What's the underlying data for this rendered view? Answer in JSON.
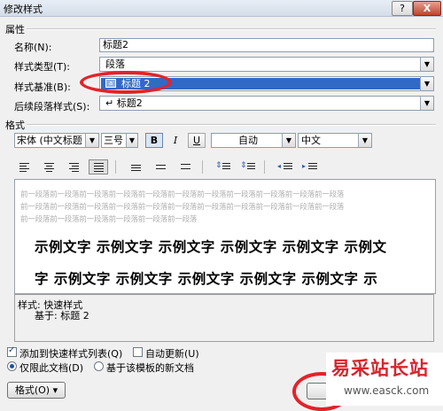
{
  "window": {
    "title": "修改样式",
    "help": "?",
    "close": "X"
  },
  "properties": {
    "section": "属性",
    "name_label": "名称(N):",
    "name_value": "标题2",
    "type_label": "样式类型(T):",
    "type_value": "段落",
    "based_label": "样式基准(B):",
    "based_value": "标题 2",
    "next_label": "后续段落样式(S):",
    "next_value": "↵ 标题2"
  },
  "format": {
    "section": "格式",
    "font": "宋体 (中文标题",
    "size": "三号",
    "bold": "B",
    "italic": "I",
    "underline": "U",
    "color": "自动",
    "lang": "中文"
  },
  "preview": {
    "prev_lines": [
      "前一段落前一段落前一段落前一段落前一段落前一段落前一段落前一段落前一段落前一段落前一段落",
      "前一段落前一段落前一段落前一段落前一段落前一段落前一段落前一段落前一段落前一段落前一段落",
      "前一段落前一段落前一段落前一段落前一段落前一段落"
    ],
    "sample_line1": "示例文字 示例文字 示例文字 示例文字 示例文字 示例文",
    "sample_line2": "字 示例文字 示例文字 示例文字 示例文字 示例文字 示"
  },
  "description": {
    "line1": "样式: 快速样式",
    "line2": "基于: 标题 2"
  },
  "options": {
    "add_quick": "添加到快速样式列表(Q)",
    "auto_update": "自动更新(U)",
    "only_doc": "仅限此文档(D)",
    "new_docs": "基于该模板的新文档"
  },
  "buttons": {
    "format": "格式(O) ▾"
  },
  "watermark": {
    "cn": "易采站长站",
    "url": "www.easck.com"
  },
  "colors": {
    "annotation": "#e2232b",
    "selection": "#3169c6",
    "watermark": "#d9232d"
  }
}
